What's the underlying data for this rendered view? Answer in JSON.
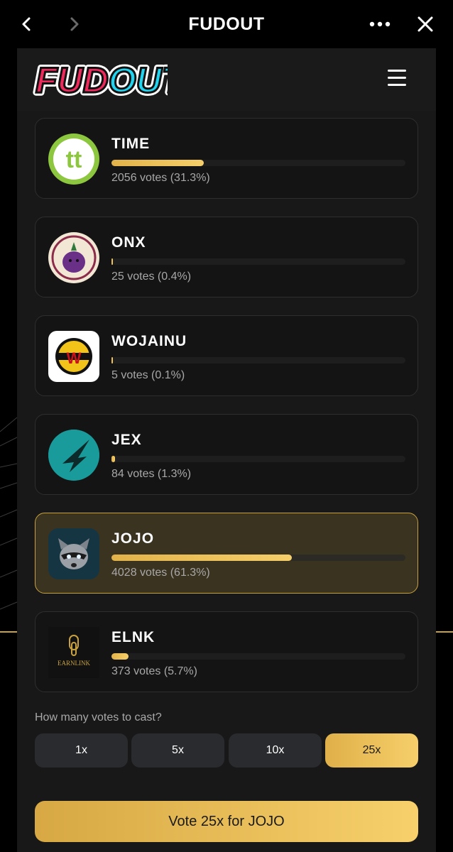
{
  "topbar": {
    "title": "FUDOUT"
  },
  "header": {
    "logo_text": "FUDOUT"
  },
  "tokens": [
    {
      "name": "TIME",
      "votes_text": "2056 votes (31.3%)",
      "share": 0.313
    },
    {
      "name": "ONX",
      "votes_text": "25 votes (0.4%)",
      "share": 0.004
    },
    {
      "name": "WOJAINU",
      "votes_text": "5 votes (0.1%)",
      "share": 0.001
    },
    {
      "name": "JEX",
      "votes_text": "84 votes (1.3%)",
      "share": 0.013
    },
    {
      "name": "JOJO",
      "votes_text": "4028 votes (61.3%)",
      "share": 0.613,
      "selected": true
    },
    {
      "name": "ELNK",
      "votes_text": "373 votes (5.7%)",
      "share": 0.057,
      "avatar_text": "EARNLINK"
    }
  ],
  "vote_panel": {
    "question": "How many votes to cast?",
    "multipliers": [
      "1x",
      "5x",
      "10x",
      "25x"
    ],
    "active_multiplier": "25x",
    "submit_label": "Vote 25x for JOJO"
  },
  "colors": {
    "accent": "#f0c45c",
    "card_bg": "#141414",
    "selected_bg": "#3a3320"
  }
}
